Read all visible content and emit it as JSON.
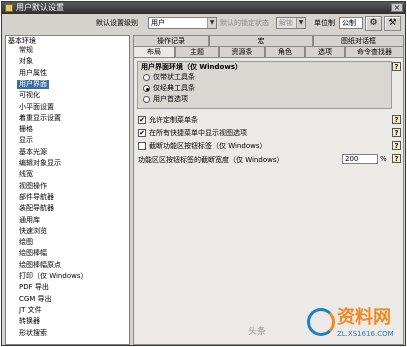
{
  "window": {
    "title": "用户默认设置"
  },
  "toolbar": {
    "level_label": "默认设置级别",
    "level_value": "用户",
    "lock_label": "默认的锁定状态",
    "lock_value": "解锁",
    "units_label": "单位制",
    "units_value": "公制"
  },
  "tree": {
    "root": "基本环境",
    "items": [
      "常规",
      "对象",
      "用户属性",
      "用户界面",
      "可视化",
      "小平面设置",
      "着重显示设置",
      "栅格",
      "显示",
      "基本光源",
      "编辑对象显示",
      "线宽",
      "视图操作",
      "部件导航器",
      "装配导航器",
      "通用库",
      "快速浏览",
      "绘图",
      "绘图棒幅",
      "绘图棒幅原点",
      "打印（仅 Windows）",
      "PDF 导出",
      "CGM 导出",
      "JT 文件",
      "转换器",
      "形状搜索"
    ],
    "selected_index": 3
  },
  "tabs": {
    "row1": [
      "操作记录",
      "宏",
      "图纸对话框"
    ],
    "row2": [
      "布局",
      "主题",
      "资源条",
      "角色",
      "选项",
      "命令查找器"
    ],
    "active": "布局"
  },
  "layout_tab": {
    "group_title": "用户界面环境（仅 Windows）",
    "radios": [
      {
        "label": "仅带状工具条",
        "checked": false
      },
      {
        "label": "仅经典工具条",
        "checked": true
      },
      {
        "label": "用户首选项",
        "checked": false
      }
    ],
    "checks": [
      {
        "label": "允许定制菜单条",
        "checked": true
      },
      {
        "label": "在所有快捷菜单中显示视图选项",
        "checked": true
      },
      {
        "label": "截断功能区按钮标签（仅 Windows）",
        "checked": false
      }
    ],
    "truncate_width_label": "功能区区按钮标签的截断宽度（仅 Windows）",
    "truncate_width_value": "200",
    "truncate_width_unit": "%",
    "help_glyph": "?"
  },
  "watermark": {
    "text": "资料网",
    "url": "ZL.XS1616.COM",
    "left_text": "头条"
  },
  "colors": {
    "selection": "#3a6ea5",
    "titlebar": "#2e2e2e",
    "panel": "#d6d3ce"
  }
}
